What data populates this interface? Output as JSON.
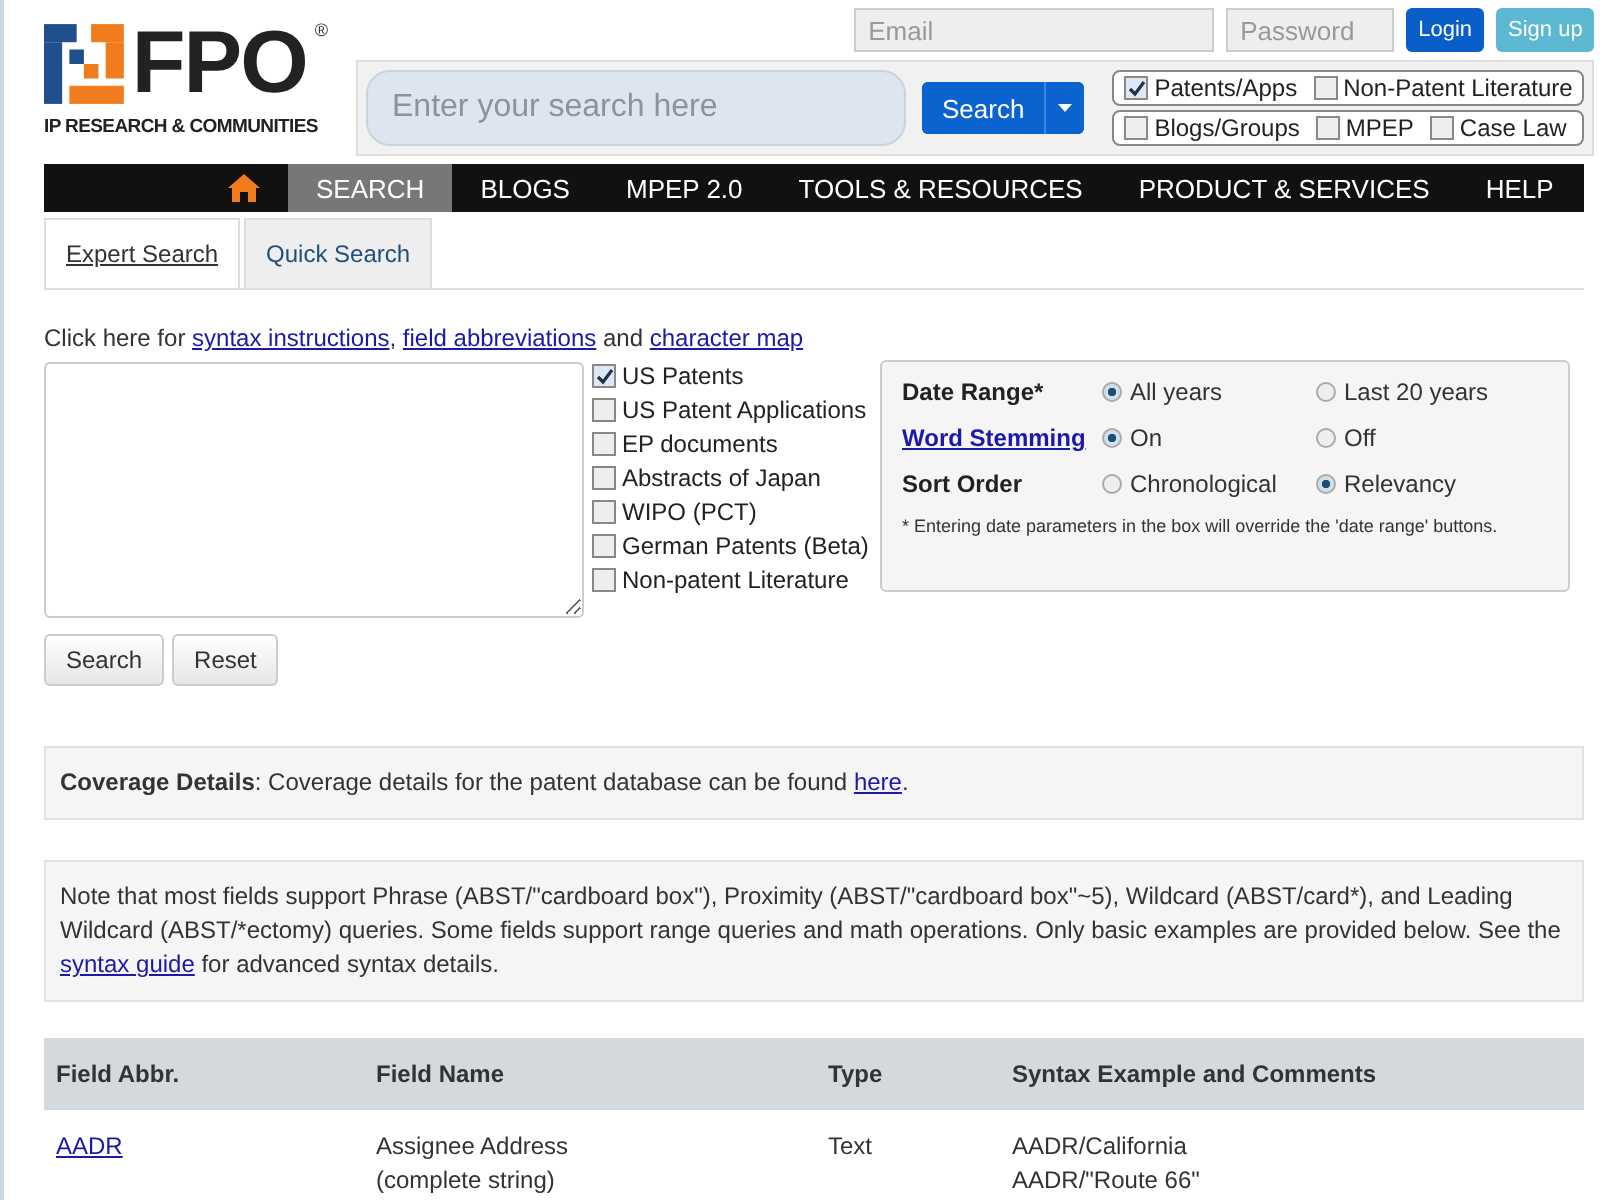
{
  "logo": {
    "name": "FPO",
    "reg": "®",
    "tagline": "IP RESEARCH & COMMUNITIES"
  },
  "login": {
    "email_placeholder": "Email",
    "password_placeholder": "Password",
    "login": "Login",
    "signup": "Sign up"
  },
  "search": {
    "placeholder": "Enter your search here",
    "button": "Search"
  },
  "sources": [
    [
      {
        "label": "Patents/Apps",
        "checked": true
      },
      {
        "label": "Non-Patent Literature",
        "checked": false
      }
    ],
    [
      {
        "label": "Blogs/Groups",
        "checked": false
      },
      {
        "label": "MPEP",
        "checked": false
      },
      {
        "label": "Case Law",
        "checked": false
      }
    ]
  ],
  "nav": [
    {
      "kind": "home",
      "selected": false
    },
    {
      "kind": "text",
      "label": "SEARCH",
      "selected": true
    },
    {
      "kind": "text",
      "label": "BLOGS",
      "selected": false
    },
    {
      "kind": "text",
      "label": "MPEP 2.0",
      "selected": false
    },
    {
      "kind": "text",
      "label": "TOOLS & RESOURCES",
      "selected": false
    },
    {
      "kind": "text",
      "label": "PRODUCT & SERVICES",
      "selected": false
    },
    {
      "kind": "text",
      "label": "HELP",
      "selected": false
    }
  ],
  "tabs": [
    {
      "label": "Expert Search",
      "selected": true
    },
    {
      "label": "Quick Search",
      "selected": false
    }
  ],
  "intro": [
    {
      "kind": "text",
      "text": "Click here for "
    },
    {
      "kind": "link",
      "text": "syntax instructions",
      "after": ", "
    },
    {
      "kind": "link",
      "text": "field abbreviations"
    },
    {
      "kind": "text",
      "text": " and "
    },
    {
      "kind": "link",
      "text": "character map"
    }
  ],
  "collections": [
    {
      "label": "US Patents",
      "checked": true
    },
    {
      "label": "US Patent Applications",
      "checked": false
    },
    {
      "label": "EP documents",
      "checked": false
    },
    {
      "label": "Abstracts of Japan",
      "checked": false
    },
    {
      "label": "WIPO (PCT)",
      "checked": false
    },
    {
      "label": "German Patents (Beta)",
      "checked": false
    },
    {
      "label": "Non-patent Literature",
      "checked": false
    }
  ],
  "options": [
    {
      "kind": "text",
      "label": "Date Range*",
      "choices": [
        {
          "label": "All years",
          "selected": true
        },
        {
          "label": "Last 20 years",
          "selected": false
        }
      ]
    },
    {
      "kind": "link",
      "label": "Word Stemming",
      "choices": [
        {
          "label": "On",
          "selected": true
        },
        {
          "label": "Off",
          "selected": false
        }
      ]
    },
    {
      "kind": "text",
      "label": "Sort Order",
      "choices": [
        {
          "label": "Chronological",
          "selected": false
        },
        {
          "label": "Relevancy",
          "selected": true
        }
      ]
    }
  ],
  "options_note": "* Entering date parameters in the box will override the 'date range' buttons.",
  "buttons": [
    "Search",
    "Reset"
  ],
  "coverage": [
    {
      "kind": "rich",
      "text": "**Coverage Details**: Coverage details for the patent database can be found "
    },
    {
      "kind": "link",
      "text": "here"
    },
    {
      "kind": "text",
      "text": "."
    }
  ],
  "note": [
    {
      "kind": "text",
      "text": "Note that most fields support Phrase (ABST/\"cardboard box\"), Proximity (ABST/\"cardboard box\"~5), Wildcard (ABST/card*), and Leading Wildcard (ABST/*ectomy) queries. Some fields support range queries and math operations. Only basic examples are provided below. See the "
    },
    {
      "kind": "link",
      "text": "syntax guide"
    },
    {
      "kind": "text",
      "text": " for advanced syntax details."
    }
  ],
  "table": {
    "columns": [
      "Field Abbr.",
      "Field Name",
      "Type",
      "Syntax Example and Comments"
    ],
    "rows": [
      {
        "abbr": "AADR",
        "name": [
          "Assignee Address",
          "(complete string)"
        ],
        "type": "Text",
        "examples": [
          "AADR/California",
          "AADR/\"Route 66\""
        ]
      }
    ]
  }
}
